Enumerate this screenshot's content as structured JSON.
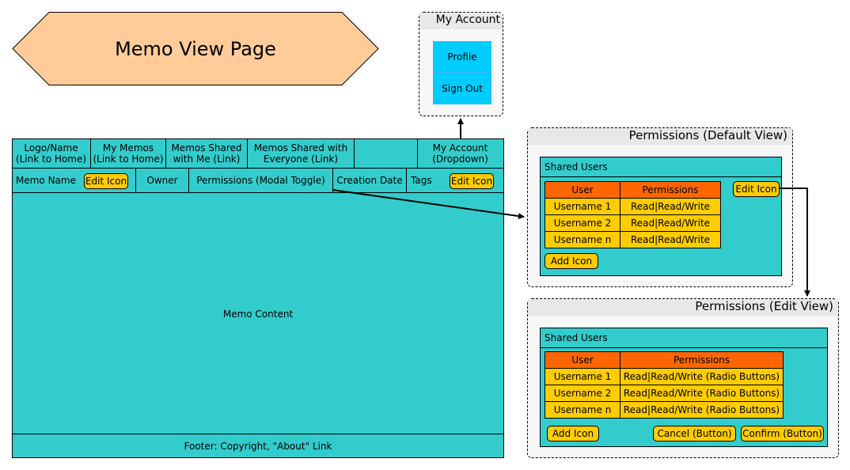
{
  "title": "Memo View Page",
  "colors": {
    "teal": "#33cccc",
    "orange": "#ff6600",
    "yellow": "#ffcc00",
    "blue": "#00ccff",
    "hexagon": "#ffcc99"
  },
  "account_menu": {
    "title": "My Account",
    "items": [
      "Profile",
      "Sign Out"
    ]
  },
  "nav": {
    "items": [
      "Logo/Name (Link to Home)",
      "My Memos (Link to Home)",
      "Memos Shared with Me (Link)",
      "Memos Shared with Everyone (Link)",
      "",
      "My Account (Dropdown)"
    ]
  },
  "memo_bar": {
    "name": "Memo Name",
    "edit1": "Edit Icon",
    "owner": "Owner",
    "permissions": "Permissions (Modal Toggle)",
    "date": "Creation Date",
    "tags": "Tags",
    "edit2": "Edit Icon"
  },
  "content": "Memo Content",
  "footer": "Footer: Copyright, \"About\" Link",
  "perm_default": {
    "title": "Permissions (Default View)",
    "box_title": "Shared Users",
    "headers": [
      "User",
      "Permissions"
    ],
    "rows": [
      [
        "Username 1",
        "Read|Read/Write"
      ],
      [
        "Username 2",
        "Read|Read/Write"
      ],
      [
        "Username n",
        "Read|Read/Write"
      ]
    ],
    "add": "Add Icon",
    "edit": "Edit Icon"
  },
  "perm_edit": {
    "title": "Permissions (Edit View)",
    "box_title": "Shared Users",
    "headers": [
      "User",
      "Permissions"
    ],
    "rows": [
      [
        "Username 1",
        "Read|Read/Write (Radio Buttons)"
      ],
      [
        "Username 2",
        "Read|Read/Write (Radio Buttons)"
      ],
      [
        "Username n",
        "Read|Read/Write (Radio Buttons)"
      ]
    ],
    "add": "Add Icon",
    "cancel": "Cancel (Button)",
    "confirm": "Confirm (Button)"
  }
}
